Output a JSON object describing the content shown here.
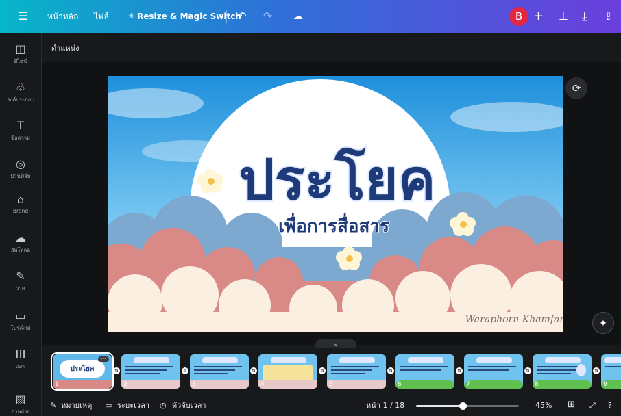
{
  "topbar": {
    "menu_icon": "hamburger-menu-icon",
    "home_label": "หน้าหลัก",
    "file_label": "ไฟล์",
    "resize_label": "Resize & Magic Switch",
    "avatar_letter": "B"
  },
  "sidebar": {
    "items": [
      {
        "label": "ดีไซน์",
        "icon": "design-icon",
        "glyph": "◫"
      },
      {
        "label": "องค์ประกอบ",
        "icon": "elements-icon",
        "glyph": "♧"
      },
      {
        "label": "ข้อความ",
        "icon": "text-icon",
        "glyph": "T"
      },
      {
        "label": "ม้วนฟิล์ม",
        "icon": "camera-icon",
        "glyph": "◎"
      },
      {
        "label": "Brand",
        "icon": "brand-icon",
        "glyph": "⌂"
      },
      {
        "label": "อัพโหลด",
        "icon": "upload-icon",
        "glyph": "☁"
      },
      {
        "label": "วาด",
        "icon": "draw-icon",
        "glyph": "✎"
      },
      {
        "label": "โปรเจ็กต์",
        "icon": "folder-icon",
        "glyph": "▭"
      },
      {
        "label": "แอพ",
        "icon": "apps-icon",
        "glyph": "⋮⋮"
      },
      {
        "label": "ภาพถ่าย",
        "icon": "photos-icon",
        "glyph": "▨"
      }
    ]
  },
  "subbar": {
    "position_label": "ตำแหน่ง"
  },
  "slide": {
    "title": "ประโยค",
    "subtitle": "เพื่อการสื่อสาร",
    "signature": "Waraphorn Khamfan"
  },
  "thumbnails": [
    {
      "num": "1",
      "title": "ประโยค"
    },
    {
      "num": "2",
      "title": "ความหมายของประโยค"
    },
    {
      "num": "3",
      "title": "ความหมายของประโยค"
    },
    {
      "num": "4",
      "title": "ความหมายของประโยค"
    },
    {
      "num": "5",
      "title": "ความหมายของประโยค"
    },
    {
      "num": "6",
      "title": "ประโยคตามเจตนา"
    },
    {
      "num": "7",
      "title": "ประโยคบอกเล่า"
    },
    {
      "num": "8",
      "title": "ประโยคคำถาม"
    },
    {
      "num": "9",
      "title": "ประโยค"
    }
  ],
  "bottombar": {
    "notes_label": "หมายเหตุ",
    "duration_label": "ระยะเวลา",
    "timer_label": "ตัวจับเวลา",
    "page_label": "หน้า 1 / 18",
    "zoom_label": "45%",
    "zoom_value": 0.45
  }
}
